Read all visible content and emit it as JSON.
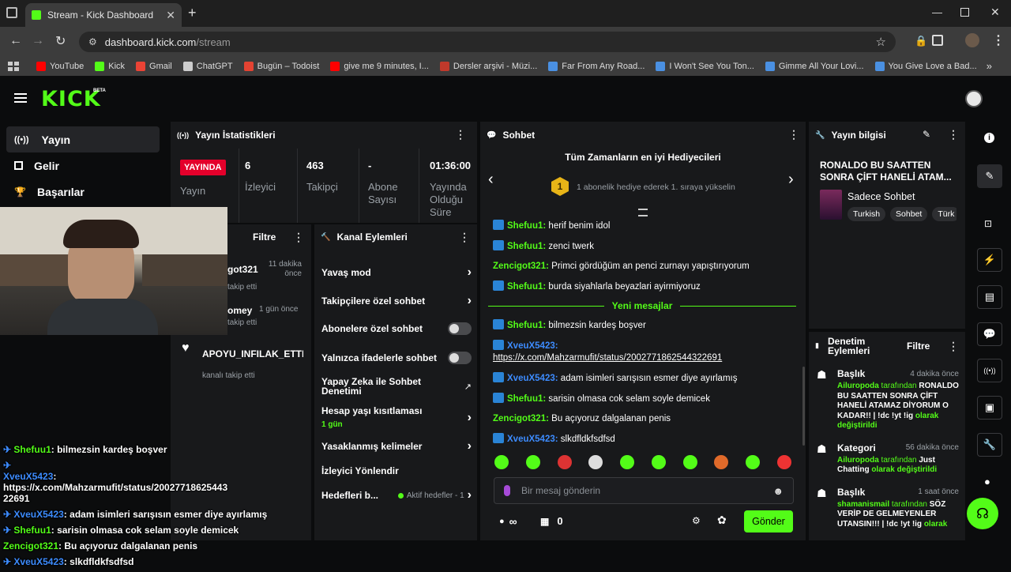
{
  "browser": {
    "tab_title": "Stream - Kick Dashboard",
    "url_host": "dashboard.kick.com",
    "url_path": "/stream",
    "bookmarks": [
      {
        "label": "YouTube",
        "color": "#ff0000"
      },
      {
        "label": "Kick",
        "color": "#53fc18"
      },
      {
        "label": "Gmail",
        "color": "#ea4335"
      },
      {
        "label": "ChatGPT",
        "color": "#cccccc"
      },
      {
        "label": "Bugün – Todoist",
        "color": "#e44332"
      },
      {
        "label": "give me 9 minutes, I...",
        "color": "#ff0000"
      },
      {
        "label": "Dersler arşivi - Müzi...",
        "color": "#c0392b"
      },
      {
        "label": "Far From Any Road...",
        "color": "#4a90e2"
      },
      {
        "label": "I Won't See You Ton...",
        "color": "#4a90e2"
      },
      {
        "label": "Gimme All Your Lovi...",
        "color": "#4a90e2"
      },
      {
        "label": "You Give Love a Bad...",
        "color": "#4a90e2"
      }
    ]
  },
  "kick": {
    "logo": "KICK",
    "beta": "BETA"
  },
  "sidebar": {
    "items": [
      {
        "label": "Yayın",
        "icon": "broadcast-icon"
      },
      {
        "label": "Gelir",
        "icon": "chart-icon"
      },
      {
        "label": "Başarılar",
        "icon": "trophy-icon"
      }
    ]
  },
  "stats": {
    "title": "Yayın İstatistikleri",
    "live_badge": "YAYINDA",
    "live_label": "Yayın",
    "columns": [
      {
        "value": "6",
        "label": "İzleyici"
      },
      {
        "value": "463",
        "label": "Takipçi"
      },
      {
        "value": "-",
        "label": "Abone Sayısı"
      },
      {
        "value": "01:36:00",
        "label": "Yayında Olduğu Süre"
      }
    ]
  },
  "activity": {
    "filter": "Filtre",
    "items": [
      {
        "name": "got321",
        "time": "11 dakika önce",
        "action": "takip etti"
      },
      {
        "name": "omey",
        "time": "1 gün önce",
        "action": "takip etti"
      },
      {
        "name": "APOYU_INFILAK_ETTI",
        "time": "",
        "action": "kanalı takip etti"
      }
    ]
  },
  "channel_actions": {
    "title": "Kanal Eylemleri",
    "items": [
      {
        "label": "Yavaş mod",
        "control": "chevron"
      },
      {
        "label": "Takipçilere özel sohbet",
        "control": "chevron"
      },
      {
        "label": "Abonelere özel sohbet",
        "control": "toggle"
      },
      {
        "label": "Yalnızca ifadelerle sohbet",
        "control": "toggle"
      },
      {
        "label": "Yapay Zeka ile Sohbet Denetimi",
        "control": "external"
      },
      {
        "label": "Hesap yaşı kısıtlaması",
        "sub": "1 gün",
        "control": "chevron"
      },
      {
        "label": "Yasaklanmış kelimeler",
        "control": "chevron"
      },
      {
        "label": "İzleyici Yönlendir",
        "control": "none"
      },
      {
        "label": "Hedefleri b...",
        "sub": "Aktif hedefler - 1",
        "control": "chevron"
      }
    ]
  },
  "chat": {
    "title": "Sohbet",
    "gifters_title": "Tüm Zamanların en iyi Hediyecileri",
    "gifter_rank": "1",
    "gifter_text": "1 abonelik hediye ederek 1. sıraya yükselin",
    "new_messages": "Yeni mesajlar",
    "messages_before": [
      {
        "user": "Shefuu1",
        "color": "g",
        "badge": true,
        "text": "herif benim idol"
      },
      {
        "user": "Shefuu1",
        "color": "g",
        "badge": true,
        "text": "zenci twerk"
      },
      {
        "user": "Zencigot321",
        "color": "g",
        "badge": false,
        "text": "Primci gördüğüm an penci zurnayı yapıştırıyorum"
      },
      {
        "user": "Shefuu1",
        "color": "g",
        "badge": true,
        "text": "burda siyahlarla beyazlari ayirmiyoruz"
      }
    ],
    "messages_after": [
      {
        "user": "Shefuu1",
        "color": "g",
        "badge": true,
        "text": "bilmezsin kardeş boşver"
      },
      {
        "user": "XveuX5423",
        "color": "b",
        "badge": true,
        "text": "https://x.com/Mahzarmufit/status/2002771862544322691",
        "link": true
      },
      {
        "user": "XveuX5423",
        "color": "b",
        "badge": true,
        "text": "adam isimleri sarışısın esmer diye ayırlamış"
      },
      {
        "user": "Shefuu1",
        "color": "g",
        "badge": true,
        "text": "sarisin olmasa cok selam soyle demicek"
      },
      {
        "user": "Zencigot321",
        "color": "g",
        "badge": false,
        "text": "Bu açıyoruz dalgalanan penis"
      },
      {
        "user": "XveuX5423",
        "color": "b",
        "badge": true,
        "text": "slkdfldkfsdfsd"
      }
    ],
    "input_placeholder": "Bir mesaj gönderin",
    "points": "∞",
    "store_count": "0",
    "send_label": "Gönder"
  },
  "stream_info": {
    "title": "Yayın bilgisi",
    "stream_title": "RONALDO BU SAATTEN SONRA ÇİFT HANELİ ATAM...",
    "category": "Sadece Sohbet",
    "tags": [
      "Turkish",
      "Sohbet",
      "Türk"
    ]
  },
  "moderation": {
    "title": "Denetim Eylemleri",
    "filter": "Filtre",
    "items": [
      {
        "type": "Başlık",
        "time": "4 dakika önce",
        "user": "Ailuropoda",
        "middle": " tarafından ",
        "value": "RONALDO BU SAATTEN SONRA ÇİFT HANELİ ATAMAZ DİYORUM O KADAR!! | !dc !yt !ig",
        "suffix": " olarak değiştirildi"
      },
      {
        "type": "Kategori",
        "time": "56 dakika önce",
        "user": "Ailuropoda",
        "middle": " tarafından ",
        "value": "Just Chatting",
        "suffix": " olarak değiştirildi"
      },
      {
        "type": "Başlık",
        "time": "1 saat önce",
        "user": "shamanismail",
        "middle": " tarafından ",
        "value": "SÖZ VERİP DE GELMEYENLER UTANSIN!!! | !dc !yt !ig",
        "suffix": " olarak"
      }
    ]
  },
  "overlay_chat": [
    {
      "user": "Shefuu1",
      "color": "g",
      "badge": true,
      "text": "bilmezsin kardeş boşver"
    },
    {
      "user": "XveuX5423",
      "color": "b",
      "badge": true,
      "text": "https://x.com/Mahzarmufit/status/20027718625443",
      "cont": "22691"
    },
    {
      "user": "XveuX5423",
      "color": "b",
      "badge": true,
      "text": "adam isimleri sarışısın esmer diye ayırlamış"
    },
    {
      "user": "Shefuu1",
      "color": "g",
      "badge": true,
      "text": "sarisin olmasa cok selam soyle demicek"
    },
    {
      "user": "Zencigot321",
      "color": "g",
      "badge": false,
      "text": "Bu açıyoruz dalgalanan penis"
    },
    {
      "user": "XveuX5423",
      "color": "b",
      "badge": true,
      "text": "slkdfldkfsdfsd"
    }
  ],
  "colors": {
    "accent": "#53fc18",
    "live": "#e4002b",
    "link": "#3d8cff"
  }
}
